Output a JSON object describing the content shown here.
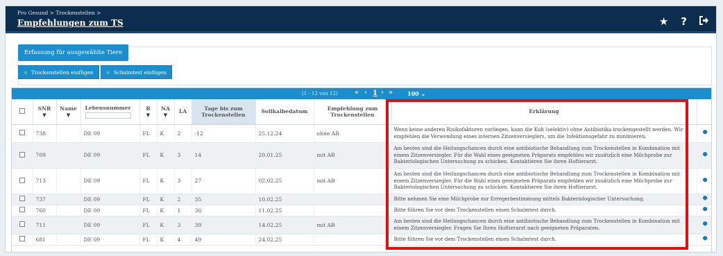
{
  "breadcrumb": {
    "items": [
      "Pro Gesund",
      "Trockenstellen"
    ],
    "separator": ">"
  },
  "page": {
    "title": "Empfehlungen zum TS"
  },
  "header_icons": [
    "star-icon",
    "help-icon",
    "logout-icon"
  ],
  "tab": {
    "label": "Erfassung für ausgewählte Tiere"
  },
  "actions": {
    "btn1": "Trockenstellen einfügen",
    "btn2": "Schalmtest einfügen"
  },
  "pager": {
    "range": "(1 - 12 von 12)",
    "current": "1",
    "page_size": "100 ⌄"
  },
  "columns": {
    "snr": "SNR",
    "name": "Name",
    "lebensnummer": "Lebensnummer",
    "r": "R",
    "na": "NA",
    "la": "LA",
    "tage": "Tage bis zum Trockenstellen",
    "soll": "Sollkalbedatum",
    "empf": "Empfehlung zum Trockenstellen",
    "erkl": "Erklärung"
  },
  "rows": [
    {
      "snr": "738",
      "name": "",
      "lnr": "DE 09",
      "r": "FL",
      "na": "K",
      "la": "2",
      "tage": "-12",
      "soll": "25.12.24",
      "empf": "ohne AB",
      "erkl": "Wenn keine anderen Risikofaktoren vorliegen, kann die Kuh (selektiv) ohne Antibiotika trockengestellt werden. Wir empfehlen die Verwendung eines internen Zitzenversieglers, um die Infektionsgefahr zu minimieren."
    },
    {
      "snr": "709",
      "name": "",
      "lnr": "DE 09",
      "r": "FL",
      "na": "K",
      "la": "3",
      "tage": "14",
      "soll": "20.01.25",
      "empf": "mit AB",
      "erkl": "Am besten sind die Heilungschancen durch eine antibiotische Behandlung zum Trockenstellen in Kombination mit einem Zitzenversiegler. Für die Wahl eines geeigneten Präparats empfehlen wir zusätzlich eine Milchprobe zur Bakteriologischen Untersuchung zu schicken. Kontaktieren Sie ihren Hoftierarzt."
    },
    {
      "snr": "713",
      "name": "",
      "lnr": "DE 09",
      "r": "FL",
      "na": "K",
      "la": "3",
      "tage": "27",
      "soll": "02.02.25",
      "empf": "mit AB",
      "erkl": "Am besten sind die Heilungschancen durch eine antibiotische Behandlung zum Trockenstellen in Kombination mit einem Zitzenversiegler. Für die Wahl eines geeigneten Präparats empfehlen wir zusätzlich eine Milchprobe zur Bakteriologischen Untersuchung zu schicken. Kontaktieren Sie ihren Hoftierarzt."
    },
    {
      "snr": "737",
      "name": "",
      "lnr": "DE 09",
      "r": "FL",
      "na": "K",
      "la": "2",
      "tage": "35",
      "soll": "10.02.25",
      "empf": "",
      "erkl": "Bitte nehmen Sie eine Milchprobe zur Erregerbestimmung mittels Bakteriologischer Untersuchung."
    },
    {
      "snr": "760",
      "name": "",
      "lnr": "DE 09",
      "r": "FL",
      "na": "K",
      "la": "1",
      "tage": "36",
      "soll": "11.02.25",
      "empf": "",
      "erkl": "Bitte führen Sie vor dem Trockenstellen einen Schalmtest durch."
    },
    {
      "snr": "711",
      "name": "",
      "lnr": "DE 09",
      "r": "FL",
      "na": "K",
      "la": "3",
      "tage": "39",
      "soll": "14.02.25",
      "empf": "mit AB",
      "erkl": "Am besten sind die Heilungschancen durch eine antibiotische Behandlung zum Trockenstellen in Kombination mit einem Zitzenversiegler. Fragen Sie Ihren Hoftierarzt nach geeigneten Präparaten."
    },
    {
      "snr": "681",
      "name": "",
      "lnr": "DE 09",
      "r": "FL",
      "na": "K",
      "la": "4",
      "tage": "49",
      "soll": "24.02.25",
      "empf": "",
      "erkl": "Bitte führen Sie vor dem Trockenstellen einen Schalmtest durch."
    }
  ],
  "colors": {
    "header_bg": "#0d2d4f",
    "accent": "#1b8ecf",
    "highlight": "#e01010"
  }
}
